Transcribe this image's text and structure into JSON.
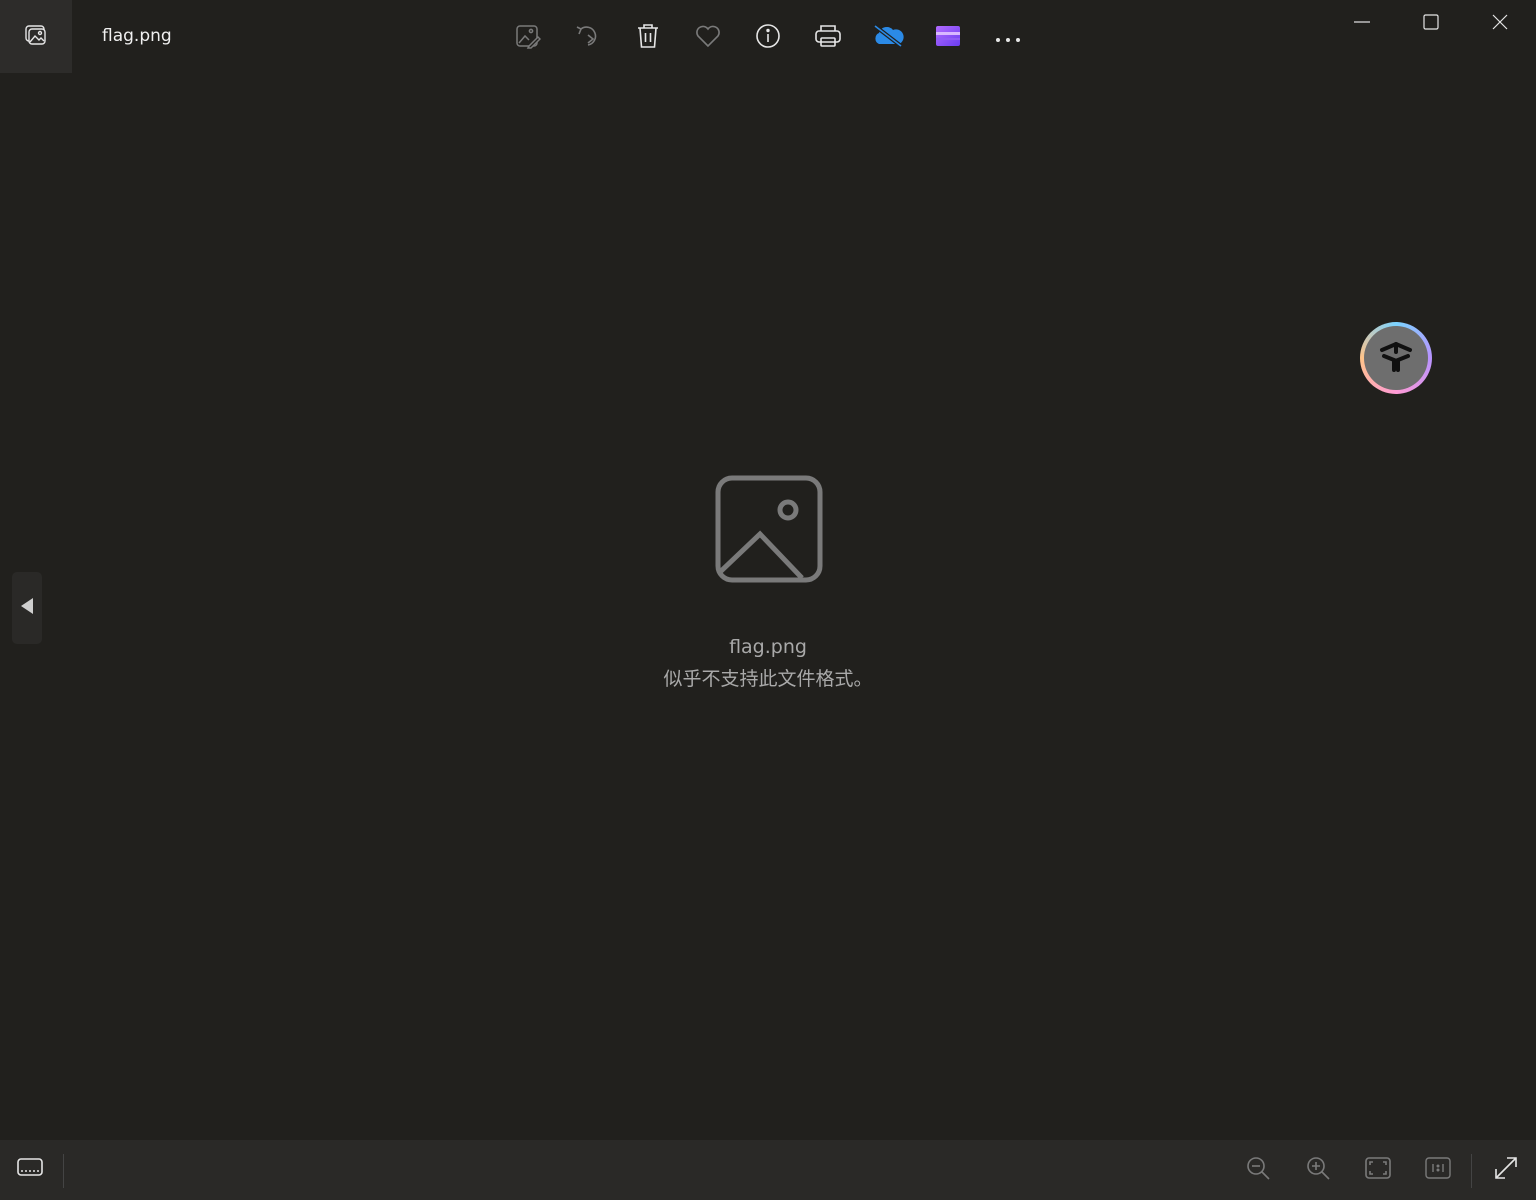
{
  "window": {
    "title": "flag.png"
  },
  "toolbar": {
    "items": [
      {
        "icon": "edit-image-icon",
        "label": "Edit"
      },
      {
        "icon": "rotate-icon",
        "label": "Rotate"
      },
      {
        "icon": "delete-icon",
        "label": "Delete"
      },
      {
        "icon": "heart-icon",
        "label": "Favorite"
      },
      {
        "icon": "info-icon",
        "label": "File info"
      },
      {
        "icon": "print-icon",
        "label": "Print"
      },
      {
        "icon": "onedrive-icon",
        "label": "OneDrive"
      },
      {
        "icon": "clipchamp-icon",
        "label": "Clipchamp"
      },
      {
        "icon": "more-icon",
        "label": "More"
      }
    ]
  },
  "window_controls": [
    "minimize-icon",
    "maximize-icon",
    "close-icon"
  ],
  "message": {
    "file_name": "flag.png",
    "error_text": "似乎不支持此文件格式。"
  },
  "bottombar": {
    "left": [
      "filmstrip-icon"
    ],
    "right": [
      "zoom-out-icon",
      "zoom-in-icon",
      "fit-to-window-icon",
      "actual-size-icon",
      "full-screen-icon"
    ]
  },
  "colors": {
    "background": "#21201d",
    "bottombar": "#2a2927",
    "icon": "#e6e6e6",
    "icon_disabled": "#7a7a7a",
    "onedrive": "#2b8ae6",
    "placeholder": "#7a7a7a"
  }
}
